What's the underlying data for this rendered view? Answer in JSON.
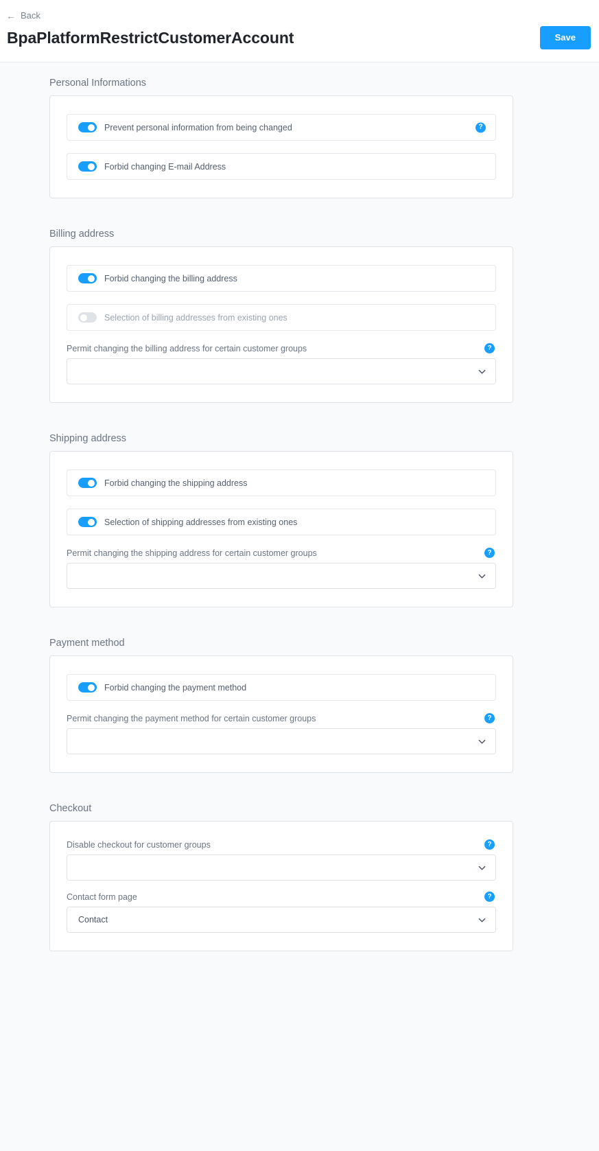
{
  "header": {
    "back_label": "Back",
    "back_icon": "arrow-left-icon",
    "title": "BpaPlatformRestrictCustomerAccount",
    "save_label": "Save",
    "accent_color": "#189eff"
  },
  "help_icon_glyph": "?",
  "sections": [
    {
      "id": "personal-informations",
      "title": "Personal Informations",
      "toggles": [
        {
          "label": "Prevent personal information from being changed",
          "state": "on",
          "has_help": true
        },
        {
          "label": "Forbid changing E-mail Address",
          "state": "on",
          "has_help": false
        }
      ],
      "fields": []
    },
    {
      "id": "billing-address",
      "title": "Billing address",
      "toggles": [
        {
          "label": "Forbid changing the billing address",
          "state": "on",
          "has_help": false
        },
        {
          "label": "Selection of billing addresses from existing ones",
          "state": "off",
          "has_help": false
        }
      ],
      "fields": [
        {
          "label": "Permit changing the billing address for certain customer groups",
          "value": "",
          "has_help": true
        }
      ]
    },
    {
      "id": "shipping-address",
      "title": "Shipping address",
      "toggles": [
        {
          "label": "Forbid changing the shipping address",
          "state": "on",
          "has_help": false
        },
        {
          "label": "Selection of shipping addresses from existing ones",
          "state": "on",
          "has_help": false
        }
      ],
      "fields": [
        {
          "label": "Permit changing the shipping address for certain customer groups",
          "value": "",
          "has_help": true
        }
      ]
    },
    {
      "id": "payment-method",
      "title": "Payment method",
      "toggles": [
        {
          "label": "Forbid changing the payment method",
          "state": "on",
          "has_help": false
        }
      ],
      "fields": [
        {
          "label": "Permit changing the payment method for certain customer groups",
          "value": "",
          "has_help": true
        }
      ]
    },
    {
      "id": "checkout",
      "title": "Checkout",
      "toggles": [],
      "fields": [
        {
          "label": "Disable checkout for customer groups",
          "value": "",
          "has_help": true
        },
        {
          "label": "Contact form page",
          "value": "Contact",
          "has_help": true
        }
      ]
    }
  ]
}
